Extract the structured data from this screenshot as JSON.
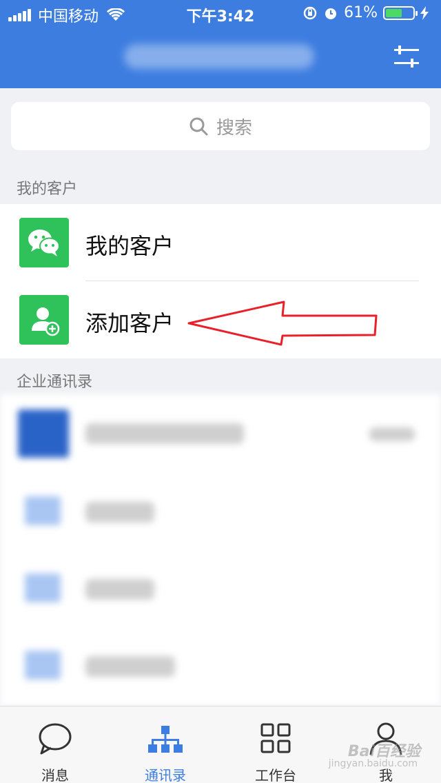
{
  "status_bar": {
    "carrier": "中国移动",
    "time": "下午3:42",
    "battery_text": "61%",
    "battery_level": 0.61
  },
  "header": {
    "filter_icon": "filter-sliders-icon"
  },
  "search": {
    "placeholder": "搜索"
  },
  "sections": {
    "my_customers_label": "我的客户",
    "directory_label": "企业通讯录"
  },
  "customer_rows": [
    {
      "label": "我的客户",
      "icon": "wechat-icon",
      "icon_color": "#2fc25b"
    },
    {
      "label": "添加客户",
      "icon": "add-user-icon",
      "icon_color": "#2fc25b"
    }
  ],
  "tabs": [
    {
      "label": "消息",
      "icon": "chat-bubble-icon",
      "active": false
    },
    {
      "label": "通讯录",
      "icon": "org-chart-icon",
      "active": true
    },
    {
      "label": "工作台",
      "icon": "grid-icon",
      "active": false
    },
    {
      "label": "我",
      "icon": "person-icon",
      "active": false
    }
  ],
  "colors": {
    "header_blue": "#3d7de0",
    "accent_green": "#2fc25b",
    "arrow_red": "#e8202a"
  },
  "watermark": {
    "brand": "Bai百经验",
    "url": "jingyan.baidu.com"
  }
}
